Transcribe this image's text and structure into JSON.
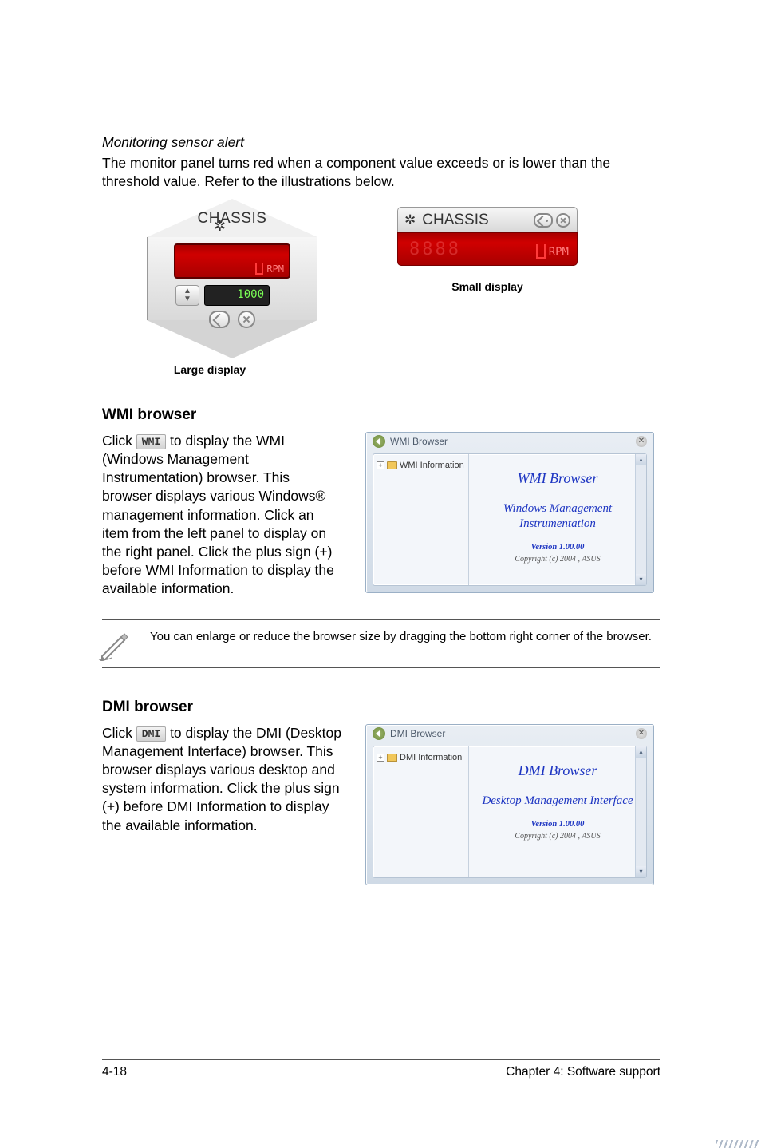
{
  "sensor_alert": {
    "heading": "Monitoring sensor alert",
    "body": "The monitor panel turns red when a component value exceeds or is lower than the threshold value. Refer to the illustrations below.",
    "large_caption": "Large display",
    "small_caption": "Small display",
    "panel_title": "CHASSIS",
    "rpm_label": "RPM",
    "threshold_value": "1000",
    "digit_placeholder": "8888"
  },
  "wmi": {
    "title": "WMI browser",
    "btn_label": "WMI",
    "text_prefix": "Click ",
    "text_after": " to display the WMI (Windows Management Instrumentation) browser. This browser displays various Windows® management information. Click an item from the left panel to display on the right panel. Click the plus sign (+) before WMI Information to display the available information.",
    "window": {
      "title": "WMI Browser",
      "tree_root": "WMI Information",
      "content_title": "WMI Browser",
      "content_sub": "Windows Management Instrumentation",
      "version": "Version 1.00.00",
      "copyright": "Copyright (c) 2004 , ASUS"
    }
  },
  "note": {
    "text": "You can enlarge or reduce the browser size by dragging the bottom right corner of the browser."
  },
  "dmi": {
    "title": "DMI browser",
    "btn_label": "DMI",
    "text_prefix": "Click ",
    "text_after": " to display the DMI (Desktop Management Interface) browser. This browser displays various desktop and system information. Click the plus sign (+) before DMI Information to display the available information.",
    "window": {
      "title": "DMI Browser",
      "tree_root": "DMI Information",
      "content_title": "DMI Browser",
      "content_sub": "Desktop Management Interface",
      "version": "Version 1.00.00",
      "copyright": "Copyright (c) 2004 , ASUS"
    }
  },
  "footer": {
    "left": "4-18",
    "right": "Chapter 4: Software support"
  }
}
